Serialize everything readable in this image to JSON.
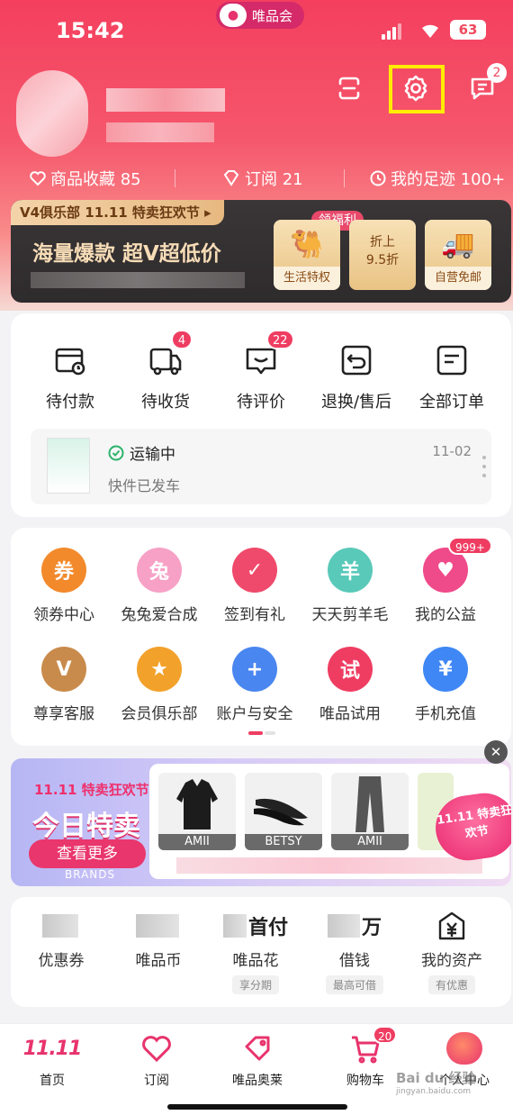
{
  "status": {
    "time": "15:42",
    "app_name": "唯品会",
    "battery": "63"
  },
  "header": {
    "message_badge": "2"
  },
  "stats": [
    {
      "label": "商品收藏 85"
    },
    {
      "label": "订阅 21"
    },
    {
      "label": "我的足迹 100+"
    }
  ],
  "vip": {
    "tag": "V4俱乐部  11.11 特卖狂欢节 ▸",
    "slogan": "海量爆款 超V超低价",
    "welfare": "领福利",
    "benefits": [
      {
        "label": "生活特权",
        "icon": "camel-icon"
      },
      {
        "label": "折上\n9.5折",
        "top": "折上",
        "bottom": "9.5折",
        "icon": "coupon-icon"
      },
      {
        "label": "自营免邮",
        "icon": "truck-icon"
      }
    ]
  },
  "orders": {
    "items": [
      {
        "label": "待付款",
        "badge": ""
      },
      {
        "label": "待收货",
        "badge": "4"
      },
      {
        "label": "待评价",
        "badge": "22"
      },
      {
        "label": "退换/售后",
        "badge": ""
      },
      {
        "label": "全部订单",
        "badge": ""
      }
    ],
    "shipping": {
      "status": "运输中",
      "desc": "快件已发车",
      "date": "11-02"
    }
  },
  "services": {
    "items": [
      {
        "label": "领券中心",
        "glyph": "券",
        "color": "#f28a2b",
        "badge": ""
      },
      {
        "label": "兔兔爱合成",
        "glyph": "兔",
        "color": "#f7a1c6",
        "badge": ""
      },
      {
        "label": "签到有礼",
        "glyph": "✓",
        "color": "#ef4a6b",
        "badge": ""
      },
      {
        "label": "天天剪羊毛",
        "glyph": "羊",
        "color": "#59c9b9",
        "badge": ""
      },
      {
        "label": "我的公益",
        "glyph": "♥",
        "color": "#ef4a8a",
        "badge": "999+"
      },
      {
        "label": "尊享客服",
        "glyph": "V",
        "color": "#c98b4b",
        "badge": ""
      },
      {
        "label": "会员俱乐部",
        "glyph": "★",
        "color": "#f2a12b",
        "badge": ""
      },
      {
        "label": "账户与安全",
        "glyph": "+",
        "color": "#4a86f0",
        "badge": ""
      },
      {
        "label": "唯品试用",
        "glyph": "试",
        "color": "#ef3d62",
        "badge": ""
      },
      {
        "label": "手机充值",
        "glyph": "¥",
        "color": "#3f87f5",
        "badge": ""
      }
    ]
  },
  "promo": {
    "title": "11.11 特卖狂欢节",
    "big": "今日特卖",
    "more": "查看更多",
    "brands": "BRANDS",
    "badge": "11.11 特卖狂欢节",
    "products": [
      {
        "label": "AMII"
      },
      {
        "label": "BETSY"
      },
      {
        "label": "AMII"
      }
    ]
  },
  "finance": {
    "items": [
      {
        "value": "",
        "label": "优惠券",
        "sub": ""
      },
      {
        "value": "",
        "label": "唯品币",
        "sub": ""
      },
      {
        "value": "首付",
        "label": "唯品花",
        "sub": "享分期"
      },
      {
        "value": "万",
        "label": "借钱",
        "sub": "最高可借"
      },
      {
        "value": "",
        "label": "我的资产",
        "sub": "有优惠"
      }
    ]
  },
  "tabbar": {
    "items": [
      {
        "label": "首页",
        "badge": ""
      },
      {
        "label": "订阅",
        "badge": ""
      },
      {
        "label": "唯品奥莱",
        "badge": ""
      },
      {
        "label": "购物车",
        "badge": "20"
      },
      {
        "label": "个人中心",
        "badge": ""
      }
    ]
  },
  "watermark": {
    "main": "Bai du 经验",
    "sub": "jingyan.baidu.com"
  }
}
